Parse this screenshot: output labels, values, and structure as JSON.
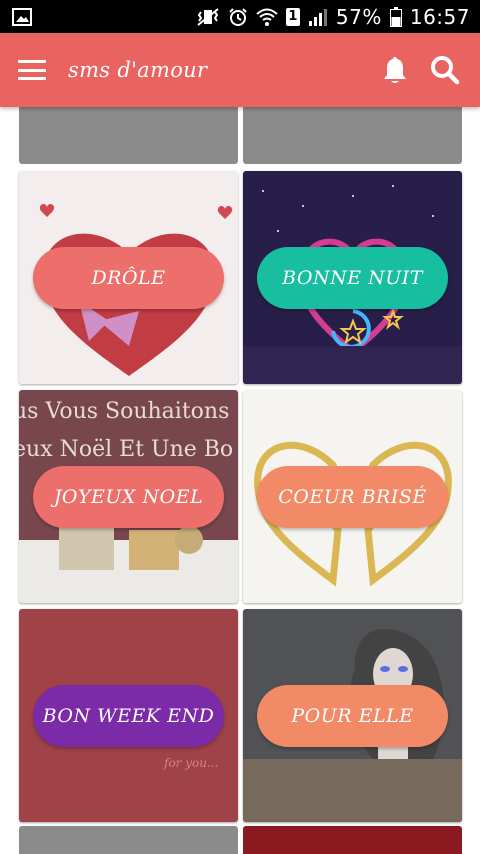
{
  "status_bar": {
    "battery": "57%",
    "time": "16:57",
    "sim_slot": "1",
    "icons": [
      "gallery-notification-icon",
      "vibrate-icon",
      "alarm-icon",
      "wifi-icon",
      "signal-icon",
      "battery-icon"
    ]
  },
  "appbar": {
    "title": "sms d'amour",
    "color": "#e96460",
    "icons": [
      "menu-icon",
      "bell-icon",
      "search-icon"
    ]
  },
  "tiles": [
    {
      "label": "DRÔLE",
      "pill_color": "#ec6f6b"
    },
    {
      "label": "BONNE NUIT",
      "pill_color": "#17bfa0"
    },
    {
      "label": "JOYEUX NOEL",
      "pill_color": "#ec6f6b"
    },
    {
      "label": "COEUR BRISÉ",
      "pill_color": "#f28a67"
    },
    {
      "label": "BON WEEK END",
      "pill_color": "#7b2aa8"
    },
    {
      "label": "POUR ELLE",
      "pill_color": "#f28a67"
    }
  ],
  "decor_text": {
    "noel_line1": "us Vous Souhaitons",
    "noel_line2": "eux Noël Et Une Bo",
    "weekend_caption": "for you..."
  }
}
